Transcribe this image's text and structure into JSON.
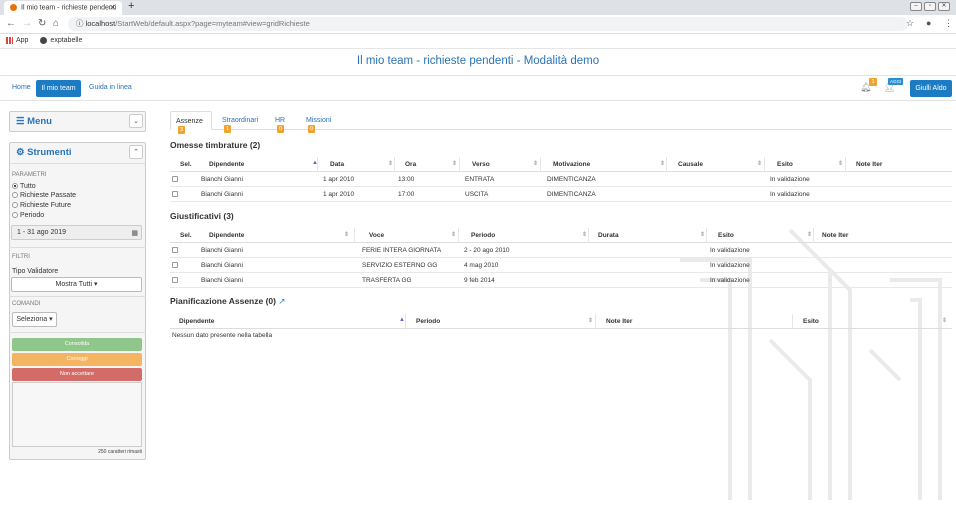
{
  "browser": {
    "tab_title": "Il mio team - richieste pendenti",
    "url_host": "localhost",
    "url_path": "/StartWeb/default.aspx?page=myteam#view=gridRichieste",
    "bookmarks": [
      "App",
      "exptabelle"
    ]
  },
  "page": {
    "title": "Il mio team - richieste pendenti - Modalità demo"
  },
  "topnav": {
    "items": [
      "Home",
      "Il mio team",
      "Guida in linea"
    ],
    "bell_count": "1",
    "user_badge": "AGGI",
    "user_name": "Giulli Aldo"
  },
  "sidebar": {
    "menu_title": "Menu",
    "tools_title": "Strumenti",
    "params_label": "PARAMETRI",
    "radios": [
      "Tutto",
      "Richieste Passate",
      "Richieste Future",
      "Periodo"
    ],
    "period_value": "1 - 31 ago 2019",
    "filters_label": "FILTRI",
    "validator_label": "Tipo Validatore",
    "show_all": "Mostra Tutti ▾",
    "commands_label": "COMANDI",
    "select_btn": "Seleziona ▾",
    "btn_consolida": "Consolida",
    "btn_correggi": "Correggi",
    "btn_nonaccettare": "Non accettare",
    "chars_left": "250 caratteri rimasti"
  },
  "tabs": [
    {
      "label": "Assenze",
      "count": "3"
    },
    {
      "label": "Straordinari",
      "count": "1"
    },
    {
      "label": "HR",
      "count": "0"
    },
    {
      "label": "Missioni",
      "count": "0"
    }
  ],
  "omesse": {
    "title": "Omesse timbrature (2)",
    "headers": [
      "Sel.",
      "Dipendente",
      "Data",
      "Ora",
      "Verso",
      "Motivazione",
      "Causale",
      "Esito",
      "Note Iter"
    ],
    "rows": [
      [
        "Bianchi Gianni",
        "1 apr 2010",
        "13:00",
        "ENTRATA",
        "DIMENTICANZA",
        "",
        "In validazione",
        ""
      ],
      [
        "Bianchi Gianni",
        "1 apr 2010",
        "17:00",
        "USCITA",
        "DIMENTICANZA",
        "",
        "In validazione",
        ""
      ]
    ]
  },
  "giustificativi": {
    "title": "Giustificativi (3)",
    "headers": [
      "Sel.",
      "Dipendente",
      "Voce",
      "Periodo",
      "Durata",
      "Esito",
      "Note Iter"
    ],
    "rows": [
      [
        "Bianchi Gianni",
        "FERIE INTERA GIORNATA",
        "2 - 20 ago 2010",
        "",
        "In validazione",
        ""
      ],
      [
        "Bianchi Gianni",
        "SERVIZIO ESTERNO GG",
        "4 mag 2010",
        "",
        "In validazione",
        ""
      ],
      [
        "Bianchi Gianni",
        "TRASFERTA GG",
        "9 feb 2014",
        "",
        "In validazione",
        ""
      ]
    ]
  },
  "pianificazione": {
    "title": "Pianificazione Assenze (0)",
    "headers": [
      "Dipendente",
      "Periodo",
      "Note Iter",
      "Esito"
    ],
    "empty": "Nessun dato presente nella tabella"
  }
}
